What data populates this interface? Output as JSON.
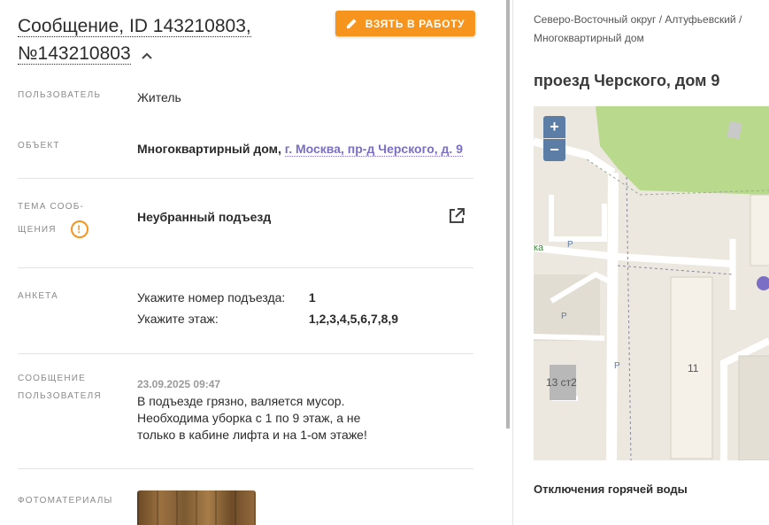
{
  "header": {
    "title_line1": "Сообщение, ID 143210803,",
    "title_line2": "№143210803",
    "take_button": "ВЗЯТЬ В РАБОТУ"
  },
  "fields": {
    "user": {
      "label": "ПОЛЬЗОВАТЕЛЬ",
      "value": "Житель"
    },
    "object": {
      "label": "ОБЪЕКТ",
      "type": "Многоквартирный дом,",
      "address": "г. Москва, пр-д Черского, д. 9"
    },
    "topic": {
      "label_line1": "ТЕМА СООБ-",
      "label_line2": "ЩЕНИЯ",
      "value": "Неубранный подъезд",
      "warn": "!"
    },
    "survey": {
      "label": "АНКЕТА",
      "rows": [
        {
          "key": "Укажите номер подъезда:",
          "value": "1"
        },
        {
          "key": "Укажите этаж:",
          "value": "1,2,3,4,5,6,7,8,9"
        }
      ]
    },
    "message": {
      "label_line1": "СООБЩЕНИЕ",
      "label_line2": "ПОЛЬЗОВАТЕЛЯ",
      "date": "23.09.2025 09:47",
      "text": "В подъезде грязно, валяется мусор. Необходима уборка с 1 по 9 этаж, а не только в кабине лифта и на 1-ом этаже!"
    },
    "photos": {
      "label": "ФОТОМАТЕРИАЛЫ"
    }
  },
  "sidebar": {
    "breadcrumb": "Северо-Восточный округ / Алтуфьевский / Многоквартирный дом",
    "address": "проезд Черского, дом 9",
    "map": {
      "zoom_in": "+",
      "zoom_out": "−",
      "label_11": "11",
      "label_13": "13 ст2",
      "label_ka": "ка",
      "parking": "P"
    },
    "hot_water": "Отключения горячей воды"
  },
  "colors": {
    "accent": "#f7941d",
    "link": "#7a6fc4",
    "map_zoom": "#5c7da6"
  }
}
